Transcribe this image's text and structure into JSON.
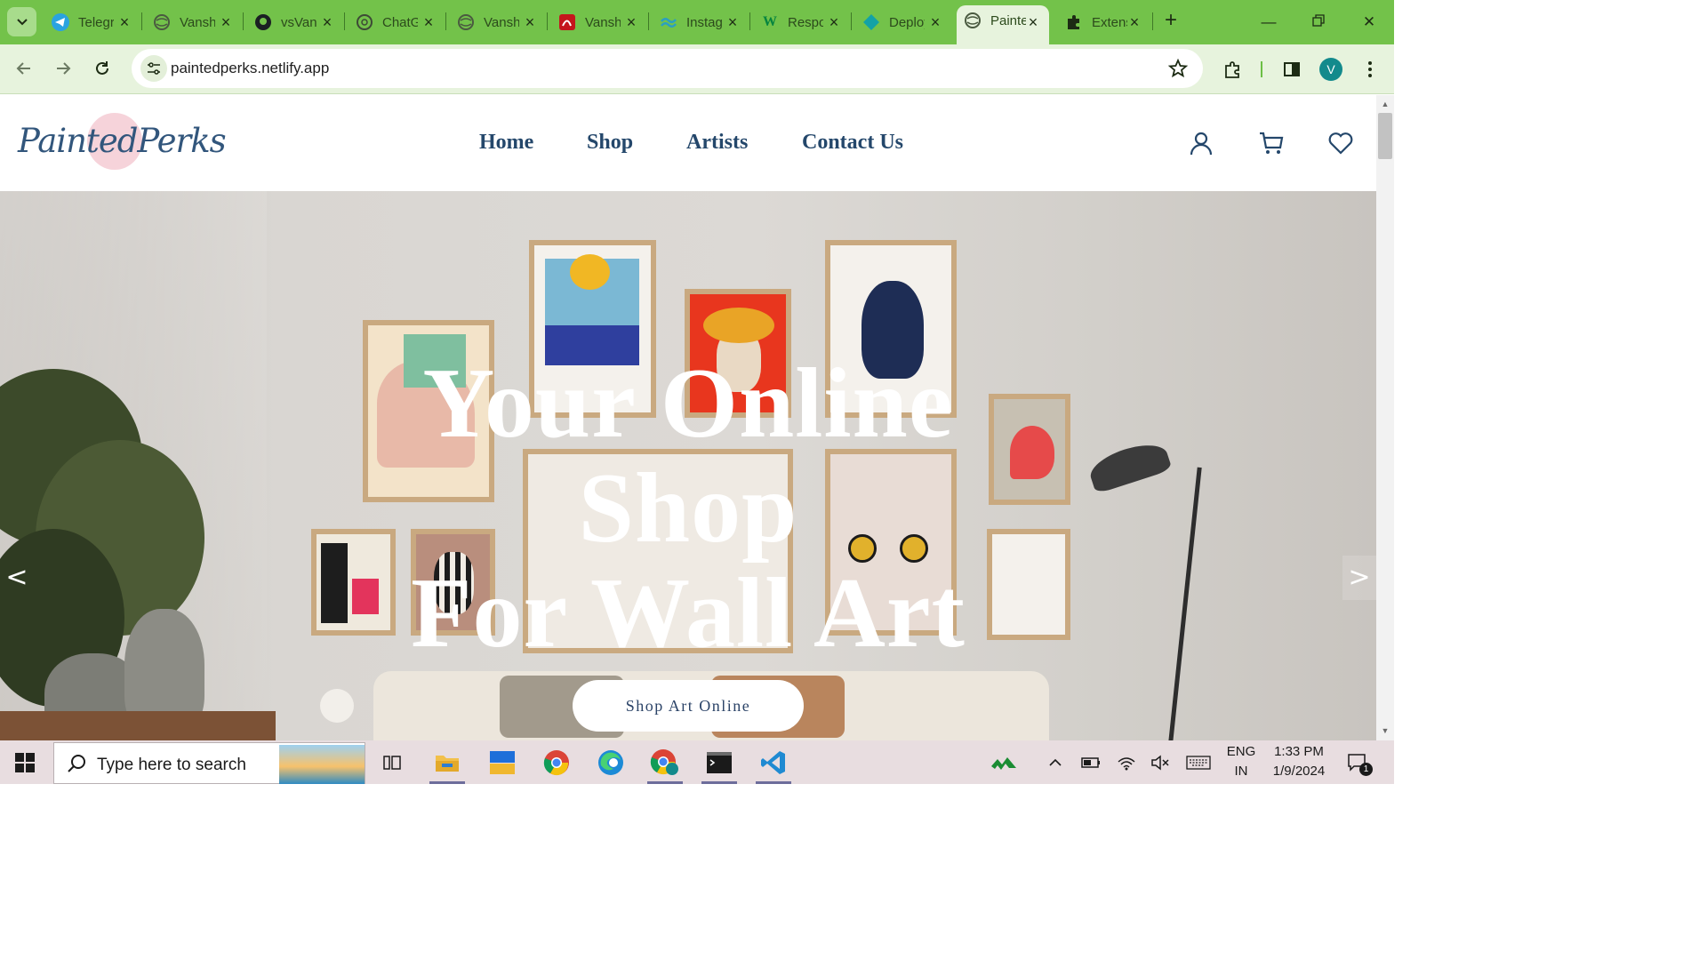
{
  "browser": {
    "tabs": [
      {
        "title": "Telegram",
        "icon": "telegram-icon"
      },
      {
        "title": "Vanshika",
        "icon": "globe-icon"
      },
      {
        "title": "vsVanshika",
        "icon": "github-icon"
      },
      {
        "title": "ChatGPT",
        "icon": "chatgpt-icon"
      },
      {
        "title": "Vanshika",
        "icon": "globe-icon"
      },
      {
        "title": "Vanshika",
        "icon": "pdf-icon"
      },
      {
        "title": "Instagram",
        "icon": "tailwind-icon"
      },
      {
        "title": "Responsive",
        "icon": "w3schools-icon"
      },
      {
        "title": "Deploy",
        "icon": "netlify-icon"
      },
      {
        "title": "PaintedPerks",
        "icon": "globe-icon"
      },
      {
        "title": "Extensions",
        "icon": "puzzle-icon"
      }
    ],
    "active_tab_index": 9,
    "url": "paintedperks.netlify.app",
    "profile_initial": "V",
    "accent_color": "#73c24a",
    "toolbar_color": "#e7f3dd"
  },
  "site": {
    "logo": "PaintedPerks",
    "nav": [
      "Home",
      "Shop",
      "Artists",
      "Contact Us"
    ],
    "header_icons": [
      "user-icon",
      "cart-icon",
      "heart-icon"
    ],
    "brand_color": "#24476b",
    "hero": {
      "title_lines": [
        "Your Online",
        "Shop",
        "For Wall Art"
      ],
      "button": "Shop Art Online",
      "prev_arrow": "<",
      "next_arrow": ">"
    }
  },
  "taskbar": {
    "search_placeholder": "Type here to search",
    "apps": [
      "task-view-icon",
      "file-explorer-icon",
      "widgets-icon",
      "chrome-icon",
      "edge-icon",
      "chrome-profile-icon",
      "terminal-icon",
      "vscode-icon"
    ],
    "tray": {
      "language_top": "ENG",
      "language_bottom": "IN",
      "time": "1:33 PM",
      "date": "1/9/2024",
      "notification_count": "1"
    }
  }
}
